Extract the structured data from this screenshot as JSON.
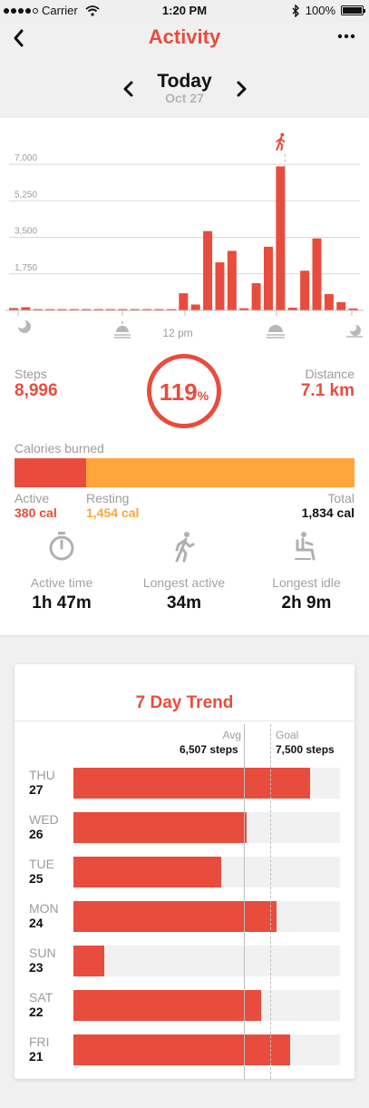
{
  "status_bar": {
    "carrier": "Carrier",
    "time": "1:20 PM",
    "battery": "100%"
  },
  "nav": {
    "title": "Activity"
  },
  "date_nav": {
    "title": "Today",
    "subtitle": "Oct 27"
  },
  "chart_data": {
    "type": "bar",
    "y_ticks": [
      "7,000",
      "5,250",
      "3,500",
      "1,750"
    ],
    "ylim": [
      0,
      7700
    ],
    "x_label_center": "12 pm",
    "values": [
      110,
      150,
      60,
      60,
      60,
      60,
      60,
      60,
      60,
      60,
      60,
      60,
      60,
      60,
      820,
      280,
      3800,
      2300,
      2850,
      100,
      1300,
      3050,
      6900,
      130,
      1900,
      3450,
      780,
      390,
      90
    ],
    "marker_index": 22,
    "colors": {
      "bar": "#e84c3d",
      "axis": "#bdbdbd",
      "grid": "#d8d8d8"
    },
    "icons": [
      "moon-icon",
      "sunrise-icon",
      "sunset-icon",
      "moon-set-icon",
      "walking-icon"
    ]
  },
  "stats": {
    "steps": {
      "label": "Steps",
      "value": "8,996"
    },
    "percent": {
      "value": "119",
      "unit": "%"
    },
    "distance": {
      "label": "Distance",
      "value": "7.1 km"
    }
  },
  "calories": {
    "label": "Calories burned",
    "active": {
      "label": "Active",
      "value": "380 cal"
    },
    "resting": {
      "label": "Resting",
      "value": "1,454 cal"
    },
    "total": {
      "label": "Total",
      "value": "1,834 cal"
    },
    "active_fraction": 0.21,
    "colors": {
      "active": "#e84c3d",
      "resting": "#ffa53b"
    }
  },
  "metrics": [
    {
      "icon": "stopwatch-icon",
      "label": "Active time",
      "value": "1h 47m"
    },
    {
      "icon": "walking-icon",
      "label": "Longest active",
      "value": "34m"
    },
    {
      "icon": "sitting-icon",
      "label": "Longest idle",
      "value": "2h 9m"
    }
  ],
  "trend": {
    "title": "7 Day Trend",
    "avg": {
      "label": "Avg",
      "value": "6,507 steps",
      "steps": 6507
    },
    "goal": {
      "label": "Goal",
      "value": "7,500 steps",
      "steps": 7500
    },
    "max_steps": 10150,
    "days": [
      {
        "name": "THU",
        "date": "27",
        "steps": 8996
      },
      {
        "name": "WED",
        "date": "26",
        "steps": 6610
      },
      {
        "name": "TUE",
        "date": "25",
        "steps": 5630
      },
      {
        "name": "MON",
        "date": "24",
        "steps": 7720
      },
      {
        "name": "SUN",
        "date": "23",
        "steps": 1160
      },
      {
        "name": "SAT",
        "date": "22",
        "steps": 7130
      },
      {
        "name": "FRI",
        "date": "21",
        "steps": 8260
      }
    ]
  }
}
